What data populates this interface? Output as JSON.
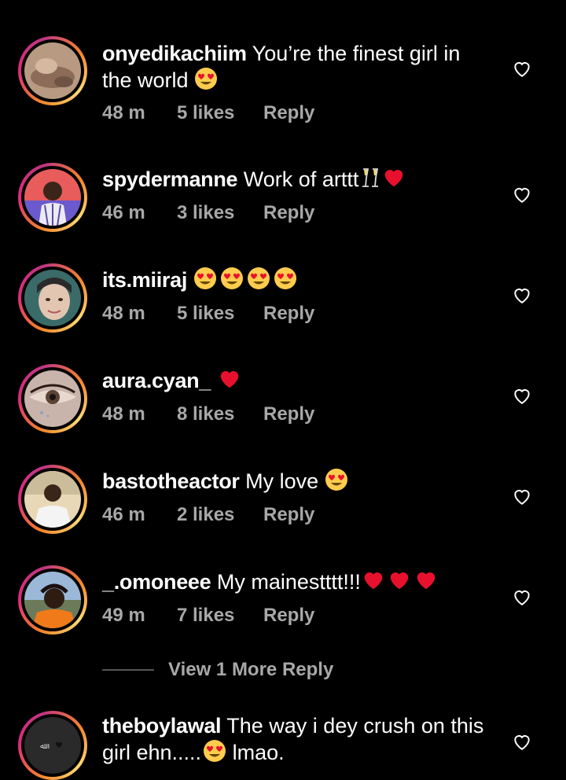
{
  "colors": {
    "background": "#000000",
    "text": "#ffffff",
    "muted": "#a8a8a8",
    "heart_red": "#e8112d",
    "ring_start": "#f58529",
    "ring_end": "#dd2a7b"
  },
  "comments": [
    {
      "username": "onyedikachiim",
      "text": "You’re the finest girl in the world",
      "emojis": [
        "heart-eyes"
      ],
      "time": "48 m",
      "likes": "5 likes",
      "reply": "Reply"
    },
    {
      "username": "spydermanne",
      "text": "Work of arttt",
      "emojis": [
        "champagne-glasses",
        "red-heart"
      ],
      "time": "46 m",
      "likes": "3 likes",
      "reply": "Reply"
    },
    {
      "username": "its.miiraj",
      "text": "",
      "emojis": [
        "heart-eyes",
        "heart-eyes",
        "heart-eyes",
        "heart-eyes"
      ],
      "time": "48 m",
      "likes": "5 likes",
      "reply": "Reply"
    },
    {
      "username": "aura.cyan_",
      "text": "",
      "emojis": [
        "red-heart"
      ],
      "time": "48 m",
      "likes": "8 likes",
      "reply": "Reply"
    },
    {
      "username": "bastotheactor",
      "text": "My love",
      "emojis": [
        "heart-eyes"
      ],
      "time": "46 m",
      "likes": "2 likes",
      "reply": "Reply"
    },
    {
      "username": "_.omoneee",
      "text": "My mainestttt!!!",
      "emojis": [
        "red-heart",
        "red-heart",
        "red-heart"
      ],
      "time": "49 m",
      "likes": "7 likes",
      "reply": "Reply"
    },
    {
      "username": "theboylawal",
      "text_part1": "The way i dey crush on this girl ehn.....",
      "text_part2": "lmao.",
      "emojis": [
        "heart-eyes"
      ]
    }
  ],
  "view_more": "View 1 More Reply"
}
